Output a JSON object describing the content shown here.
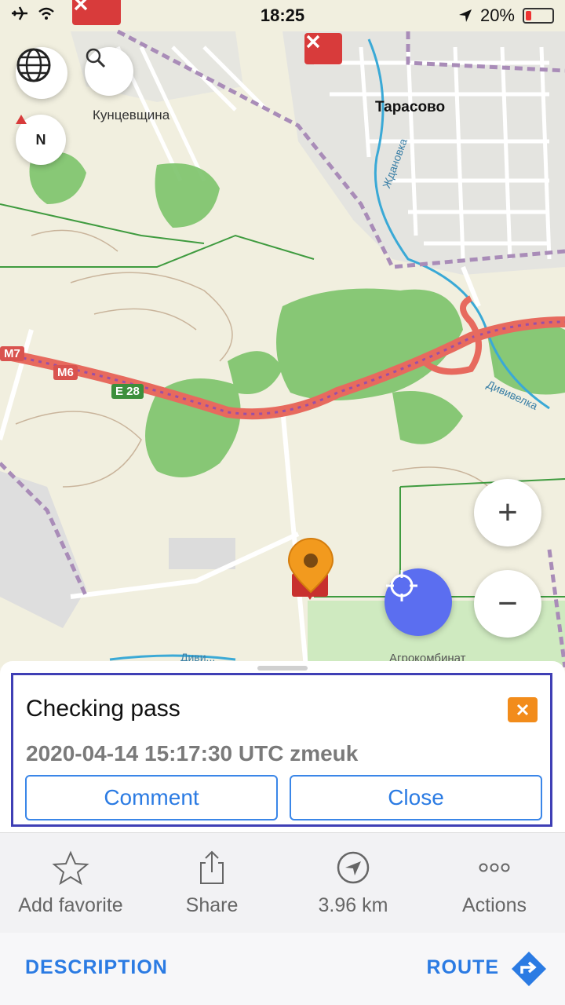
{
  "status_bar": {
    "time": "18:25",
    "battery": "20%",
    "battery_level": 0.2
  },
  "map": {
    "labels": {
      "kuntsevshchina": "Кунцевщина",
      "tarasovo": "Тарасово",
      "zhdanovka": "Ждановка",
      "divivelka": "Дививелка",
      "agrokombinat": "Агрокомбинат",
      "divye": "Диви..."
    },
    "road_badges": {
      "m7": "M7",
      "m6": "M6",
      "e28": "E 28"
    },
    "compass_letter": "N",
    "zoom_in": "+",
    "zoom_out": "−"
  },
  "note_card": {
    "title": "Checking pass",
    "meta": "2020-04-14 15:17:30 UTC zmeuk",
    "comment_button": "Comment",
    "close_button": "Close"
  },
  "toolbar": {
    "items": [
      {
        "label": "Add favorite",
        "icon": "star-icon"
      },
      {
        "label": "Share",
        "icon": "share-icon"
      },
      {
        "label": "3.96 km",
        "icon": "direction-arrow-icon"
      },
      {
        "label": "Actions",
        "icon": "more-dots-icon"
      }
    ]
  },
  "footer": {
    "description": "DESCRIPTION",
    "route": "ROUTE"
  },
  "colors": {
    "accent": "#2b7be3",
    "highlight_border": "#3f3fb5",
    "note_orange": "#f28c1b",
    "locate_blue": "#5b6ef0"
  }
}
